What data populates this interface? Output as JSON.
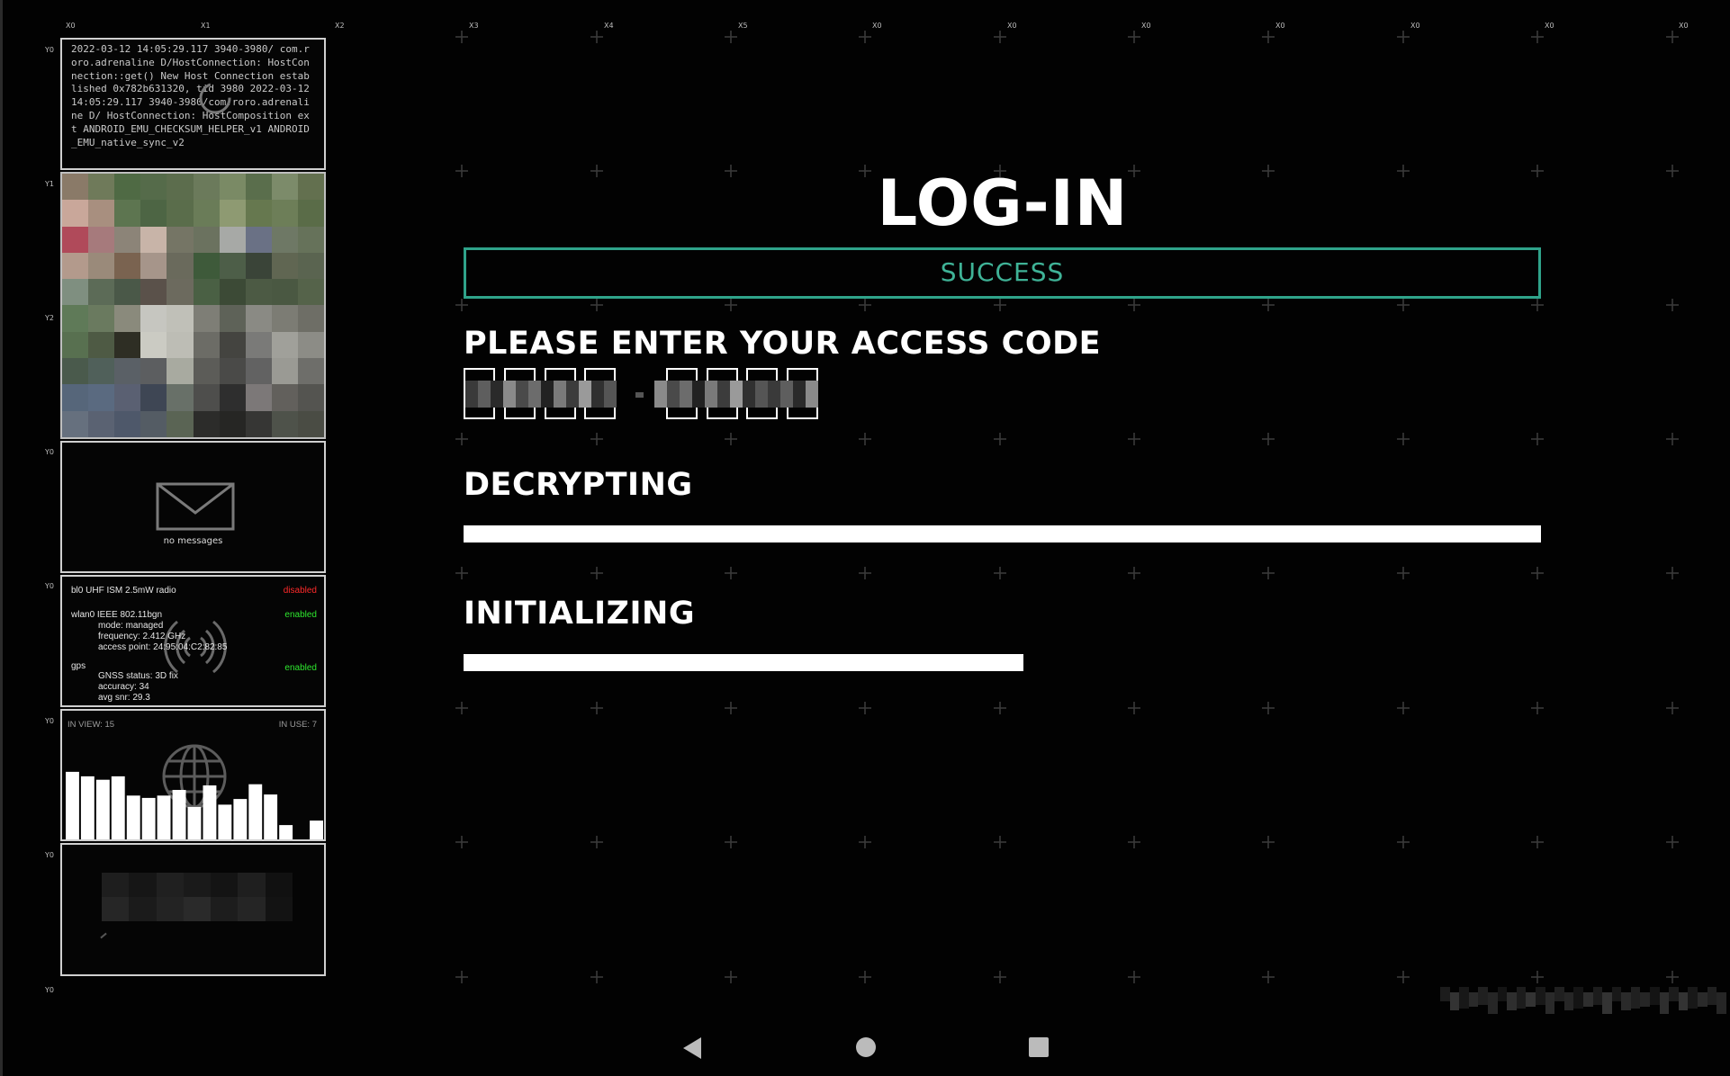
{
  "sidebar": {
    "col_labels": [
      "X0",
      "X1",
      "X2",
      "X3",
      "X4",
      "X5",
      "X0",
      "X0",
      "X0",
      "X0",
      "X0",
      "X0",
      "X0"
    ],
    "row_labels": [
      "Y0",
      "Y1",
      "Y2",
      "Y0",
      "Y0",
      "Y0",
      "Y0",
      "Y0"
    ],
    "log_text": "2022-03-12 14:05:29.117 3940-3980/ com.roro.adrenaline D/HostConnection: HostConnection::get() New Host Connection established 0x782b631320, tid 3980 2022-03-12 14:05:29.117 3940-3980/com.roro.adrenaline D/ HostConnection: HostComposition ext ANDROID_EMU_CHECKSUM_HELPER_v1 ANDROID_EMU_native_sync_v2",
    "messages_label": "no messages",
    "radio": {
      "bl0_label": "bl0 UHF ISM 2.5mW radio",
      "bl0_status": "disabled",
      "wlan0_label": "wlan0 IEEE 802.11bgn",
      "wlan0_status": "enabled",
      "wlan0_mode": "mode: managed",
      "wlan0_frequency": "frequency: 2.412 GHz",
      "wlan0_access_point": "access point: 24:95:04:C2:82:85",
      "gps_label": "gps",
      "gps_status": "enabled",
      "gnss_status": "GNSS status: 3D fix",
      "accuracy": "accuracy: 34",
      "avg_snr": "avg snr: 29.3"
    },
    "satellites": {
      "in_view": "IN VIEW: 15",
      "in_use": "IN USE: 7",
      "bar_levels": [
        0.62,
        0.58,
        0.55,
        0.58,
        0.41,
        0.39,
        0.41,
        0.46,
        0.31,
        0.5,
        0.33,
        0.38,
        0.51,
        0.42,
        0.15,
        0.02,
        0.19
      ]
    }
  },
  "main": {
    "title": "LOG-IN",
    "status": "SUCCESS",
    "access_prompt": "PLEASE ENTER YOUR ACCESS CODE",
    "decrypting_label": "DECRYPTING",
    "decrypting_progress": 1.0,
    "initializing_label": "INITIALIZING",
    "initializing_progress": 0.52
  },
  "colors": {
    "accent_green": "#3fb397",
    "status_disabled": "#ff2a2a",
    "status_enabled": "#2ee62e"
  },
  "icons": {
    "nav_back": "back-triangle-icon",
    "nav_home": "home-circle-icon",
    "nav_recents": "recents-square-icon",
    "messages": "envelope-icon",
    "radio": "signal-waves-icon",
    "satellites": "globe-icon"
  }
}
